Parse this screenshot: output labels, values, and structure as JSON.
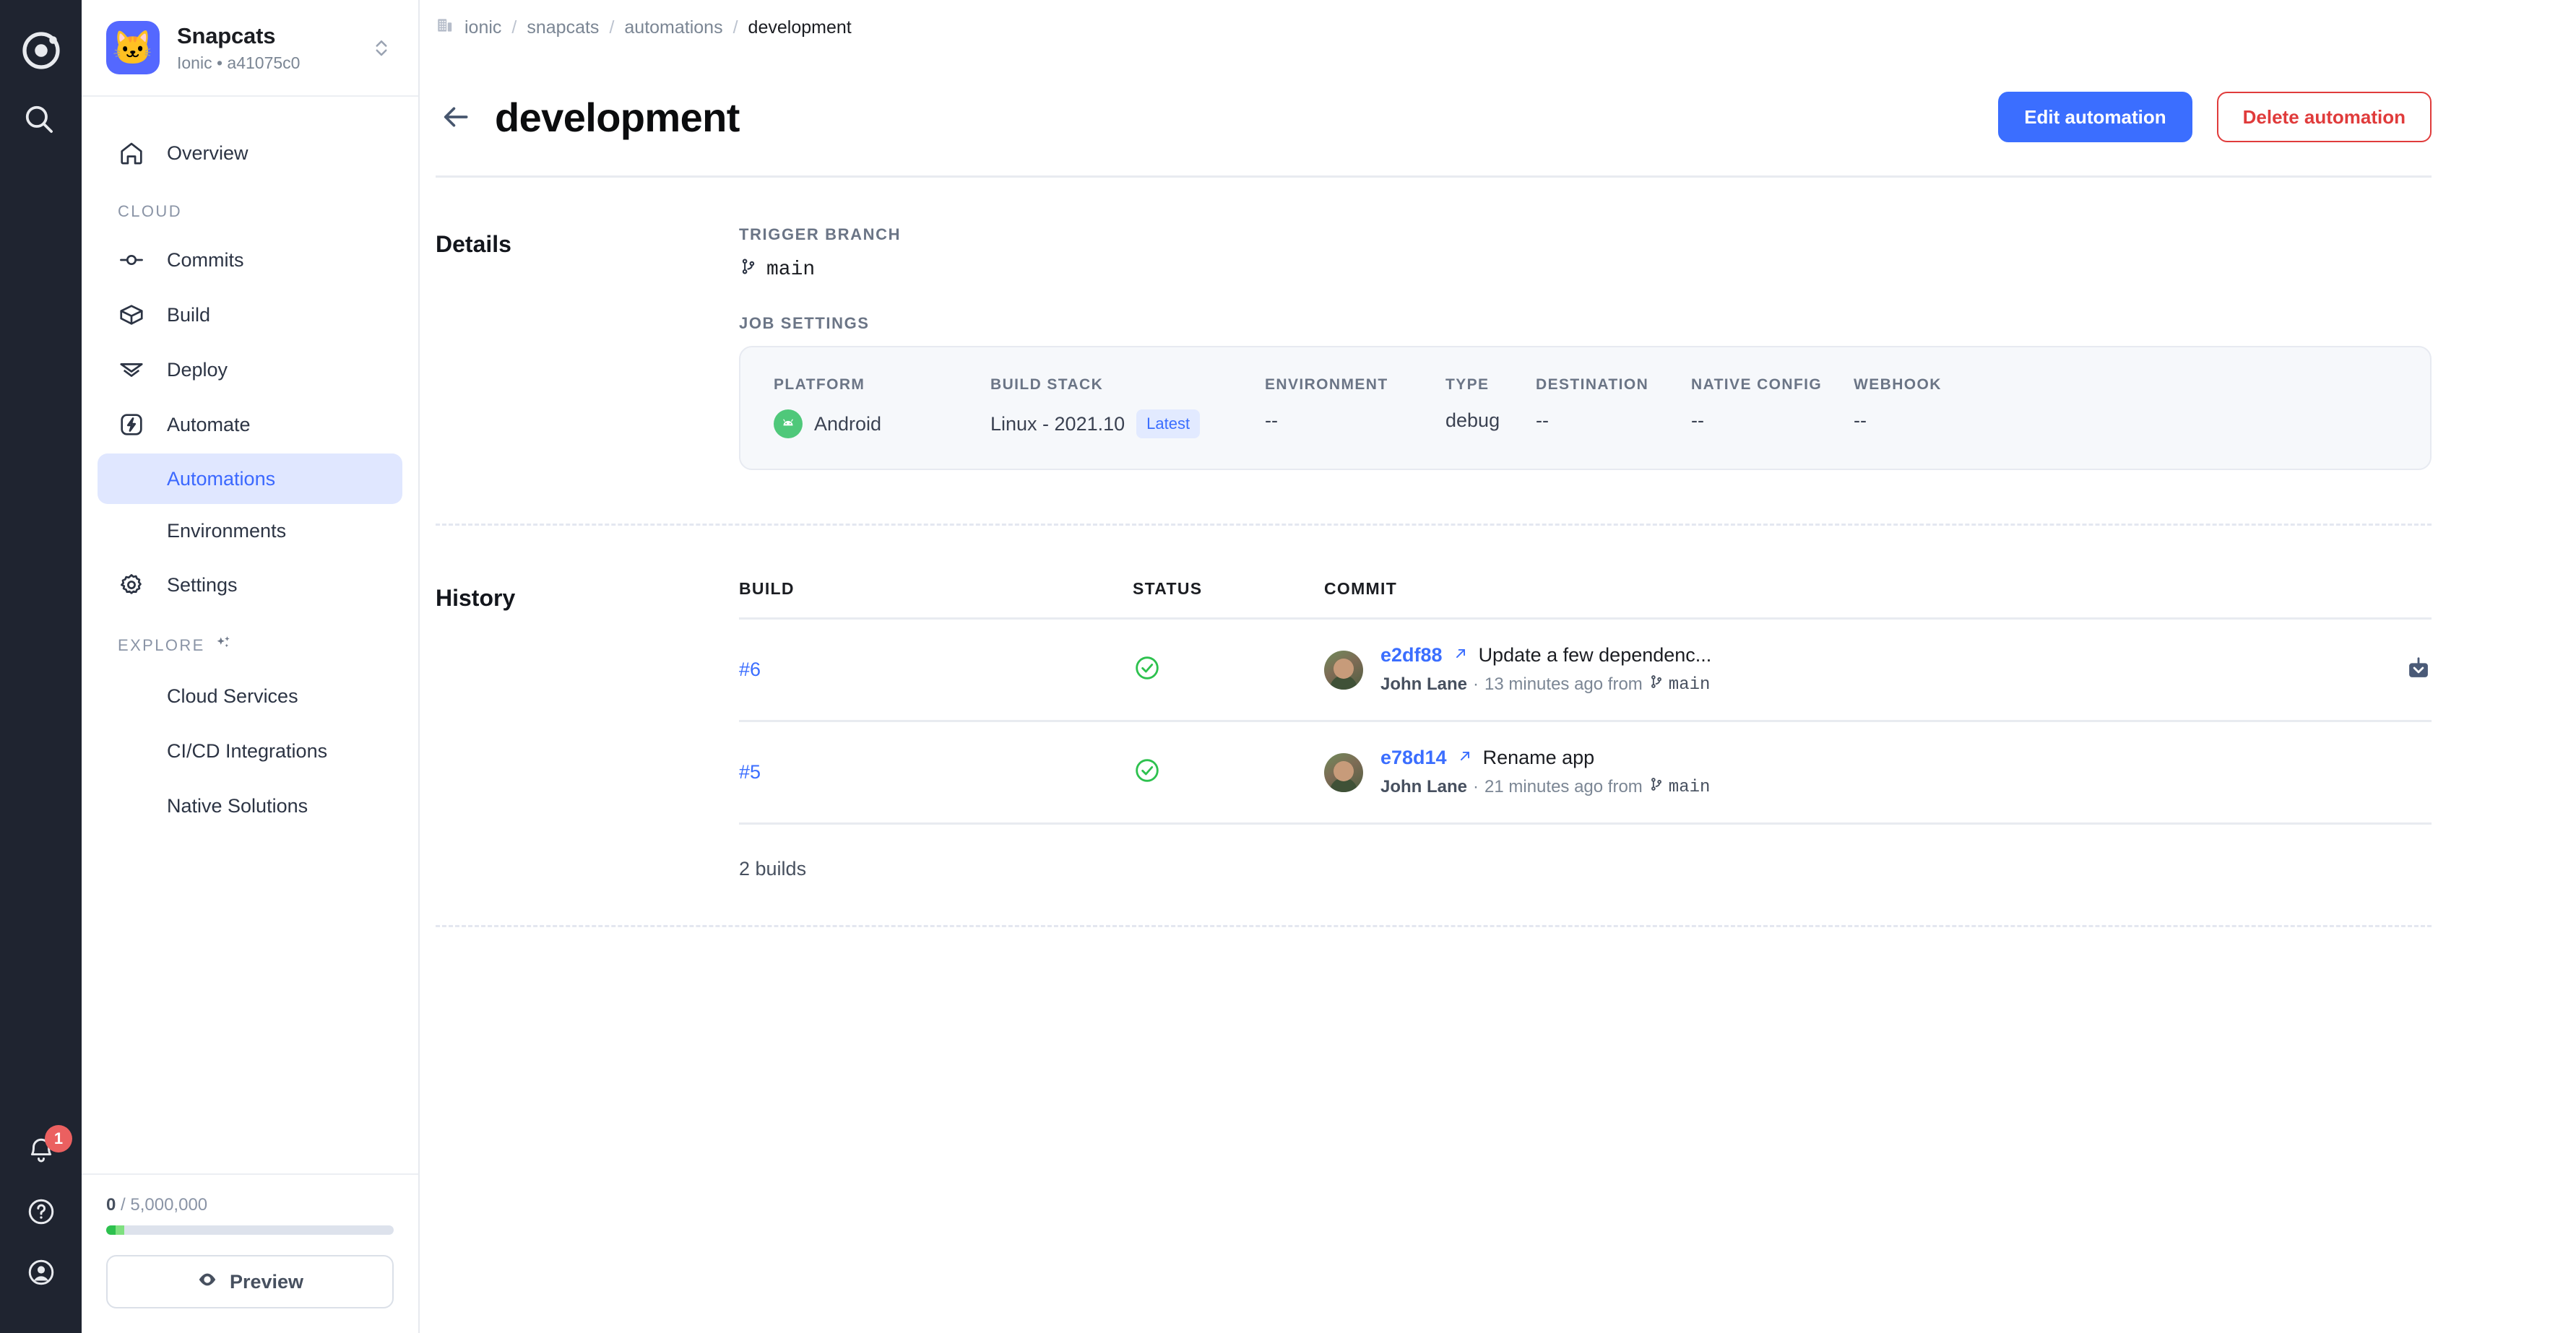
{
  "rail": {
    "logo_icon": "ionic-logo-icon",
    "search_icon": "search-icon",
    "bottom": [
      {
        "icon": "bell-icon",
        "badge": "1"
      },
      {
        "icon": "help-circle-icon",
        "badge": ""
      },
      {
        "icon": "account-circle-icon",
        "badge": ""
      }
    ]
  },
  "sidebar": {
    "project": {
      "avatar_emoji": "🐱",
      "name": "Snapcats",
      "subtitle": "Ionic • a41075c0",
      "switcher_icon": "chevron-up-down-icon"
    },
    "overview": {
      "label": "Overview",
      "icon": "home-icon"
    },
    "cloud_heading": "CLOUD",
    "cloud_items": [
      {
        "label": "Commits",
        "icon": "commit-icon"
      },
      {
        "label": "Build",
        "icon": "box-icon"
      },
      {
        "label": "Deploy",
        "icon": "deploy-icon"
      },
      {
        "label": "Automate",
        "icon": "bolt-icon"
      }
    ],
    "automate_children": [
      {
        "label": "Automations",
        "active": true
      },
      {
        "label": "Environments",
        "active": false
      }
    ],
    "settings": {
      "label": "Settings",
      "icon": "gear-icon"
    },
    "explore_heading": "EXPLORE",
    "explore_icon": "sparkles-icon",
    "explore_items": [
      {
        "label": "Cloud Services"
      },
      {
        "label": "CI/CD Integrations"
      },
      {
        "label": "Native Solutions"
      }
    ],
    "footer": {
      "quota_used": "0",
      "quota_sep": " / ",
      "quota_total": "5,000,000",
      "preview_label": "Preview",
      "preview_icon": "eye-icon"
    }
  },
  "breadcrumb": {
    "org_icon": "organization-icon",
    "items": [
      "ionic",
      "snapcats",
      "automations"
    ],
    "current": "development",
    "separator": "/"
  },
  "header": {
    "back_icon": "arrow-left-icon",
    "title": "development",
    "edit_label": "Edit automation",
    "delete_label": "Delete automation"
  },
  "details": {
    "section_label": "Details",
    "trigger_branch_label": "TRIGGER BRANCH",
    "trigger_branch_value": "main",
    "branch_icon": "git-branch-icon",
    "job_settings_label": "JOB SETTINGS",
    "job": {
      "platform_header": "PLATFORM",
      "platform_value": "Android",
      "platform_icon": "android-icon",
      "stack_header": "BUILD STACK",
      "stack_value": "Linux - 2021.10",
      "stack_badge": "Latest",
      "environment_header": "ENVIRONMENT",
      "environment_value": "--",
      "type_header": "TYPE",
      "type_value": "debug",
      "destination_header": "DESTINATION",
      "destination_value": "--",
      "native_config_header": "NATIVE CONFIG",
      "native_config_value": "--",
      "webhook_header": "WEBHOOK",
      "webhook_value": "--"
    }
  },
  "history": {
    "section_label": "History",
    "columns": {
      "build": "BUILD",
      "status": "STATUS",
      "commit": "COMMIT"
    },
    "rows": [
      {
        "build": "#6",
        "status_icon": "check-circle-icon",
        "sha": "e2df88",
        "external_icon": "external-link-icon",
        "message": "Update a few dependenc...",
        "author": "John Lane",
        "time": "13 minutes ago from",
        "branch": "main",
        "download_icon": "download-icon",
        "has_download": true
      },
      {
        "build": "#5",
        "status_icon": "check-circle-icon",
        "sha": "e78d14",
        "external_icon": "external-link-icon",
        "message": "Rename app",
        "author": "John Lane",
        "time": "21 minutes ago from",
        "branch": "main",
        "download_icon": "download-icon",
        "has_download": false
      }
    ],
    "count_label": "2 builds"
  },
  "colors": {
    "accent": "#3b6eff",
    "danger": "#e03b3b",
    "success": "#2dc14e",
    "rail": "#1f2430",
    "badge": "#eb6060"
  }
}
